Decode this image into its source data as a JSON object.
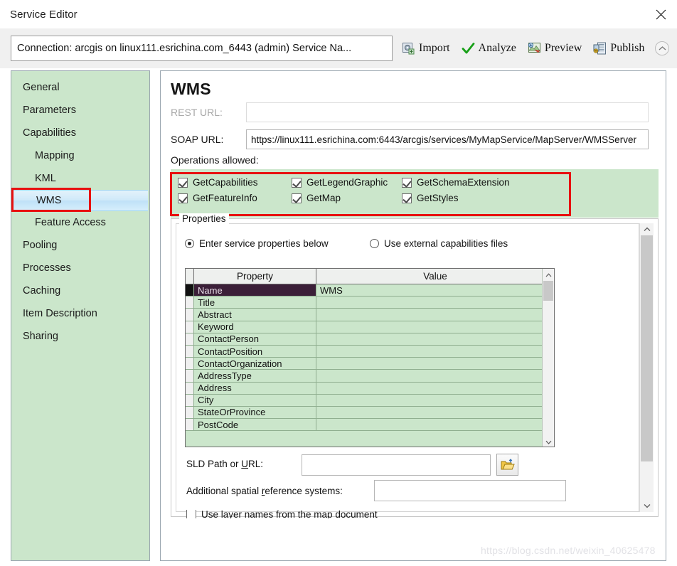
{
  "window": {
    "title": "Service Editor",
    "close_icon": "close-icon"
  },
  "toolbar": {
    "connection_text": "Connection: arcgis on linux111.esrichina.com_6443 (admin)   Service Na...",
    "actions": [
      {
        "label": "Import",
        "icon": "import-icon"
      },
      {
        "label": "Analyze",
        "icon": "check-icon"
      },
      {
        "label": "Preview",
        "icon": "preview-icon"
      },
      {
        "label": "Publish",
        "icon": "publish-icon"
      }
    ],
    "collapse_icon": "chevron-up-icon"
  },
  "sidebar": {
    "items": [
      {
        "label": "General",
        "level": 0,
        "selected": false
      },
      {
        "label": "Parameters",
        "level": 0,
        "selected": false
      },
      {
        "label": "Capabilities",
        "level": 0,
        "selected": false
      },
      {
        "label": "Mapping",
        "level": 1,
        "selected": false
      },
      {
        "label": "KML",
        "level": 1,
        "selected": false
      },
      {
        "label": "WMS",
        "level": 1,
        "selected": true
      },
      {
        "label": "Feature Access",
        "level": 1,
        "selected": false
      },
      {
        "label": "Pooling",
        "level": 0,
        "selected": false
      },
      {
        "label": "Processes",
        "level": 0,
        "selected": false
      },
      {
        "label": "Caching",
        "level": 0,
        "selected": false
      },
      {
        "label": "Item Description",
        "level": 0,
        "selected": false
      },
      {
        "label": "Sharing",
        "level": 0,
        "selected": false
      }
    ]
  },
  "main": {
    "title": "WMS",
    "rest_url": {
      "label": "REST URL:",
      "value": "",
      "disabled": true
    },
    "soap_url": {
      "label": "SOAP URL:",
      "value": "https://linux111.esrichina.com:6443/arcgis/services/MyMapService/MapServer/WMSServer"
    },
    "operations": {
      "label": "Operations allowed:",
      "items": [
        {
          "label": "GetCapabilities",
          "checked": true
        },
        {
          "label": "GetLegendGraphic",
          "checked": true
        },
        {
          "label": "GetSchemaExtension",
          "checked": true
        },
        {
          "label": "GetFeatureInfo",
          "checked": true
        },
        {
          "label": "GetMap",
          "checked": true
        },
        {
          "label": "GetStyles",
          "checked": true
        }
      ]
    },
    "properties_group": {
      "label": "Properties",
      "radios": [
        {
          "label": "Enter service properties below",
          "selected": true
        },
        {
          "label": "Use external capabilities files",
          "selected": false
        }
      ],
      "table": {
        "columns": [
          "Property",
          "Value"
        ],
        "rows": [
          {
            "property": "Name",
            "value": "WMS",
            "selected": true
          },
          {
            "property": "Title",
            "value": "",
            "selected": false
          },
          {
            "property": "Abstract",
            "value": "",
            "selected": false
          },
          {
            "property": "Keyword",
            "value": "",
            "selected": false
          },
          {
            "property": "ContactPerson",
            "value": "",
            "selected": false
          },
          {
            "property": "ContactPosition",
            "value": "",
            "selected": false
          },
          {
            "property": "ContactOrganization",
            "value": "",
            "selected": false
          },
          {
            "property": "AddressType",
            "value": "",
            "selected": false
          },
          {
            "property": "Address",
            "value": "",
            "selected": false
          },
          {
            "property": "City",
            "value": "",
            "selected": false
          },
          {
            "property": "StateOrProvince",
            "value": "",
            "selected": false
          },
          {
            "property": "PostCode",
            "value": "",
            "selected": false
          }
        ]
      },
      "sld": {
        "label_pre": "SLD Path or ",
        "label_key": "U",
        "label_post": "RL:",
        "value": ""
      },
      "srs": {
        "label_pre": "Additional spatial ",
        "label_key": "r",
        "label_post": "eference systems:",
        "value": ""
      },
      "use_layer_names": {
        "label": "Use layer names from the map document",
        "checked": false
      },
      "browse_icon": "folder-open-icon"
    }
  },
  "watermark": {
    "text": "https://blog.csdn.net/weixin_40625478"
  },
  "colors": {
    "panel_green": "#cbe6cb",
    "annotation_red": "#e81010",
    "selected_row": "#3b1f38",
    "selection_blue": "#cfe9f9"
  }
}
